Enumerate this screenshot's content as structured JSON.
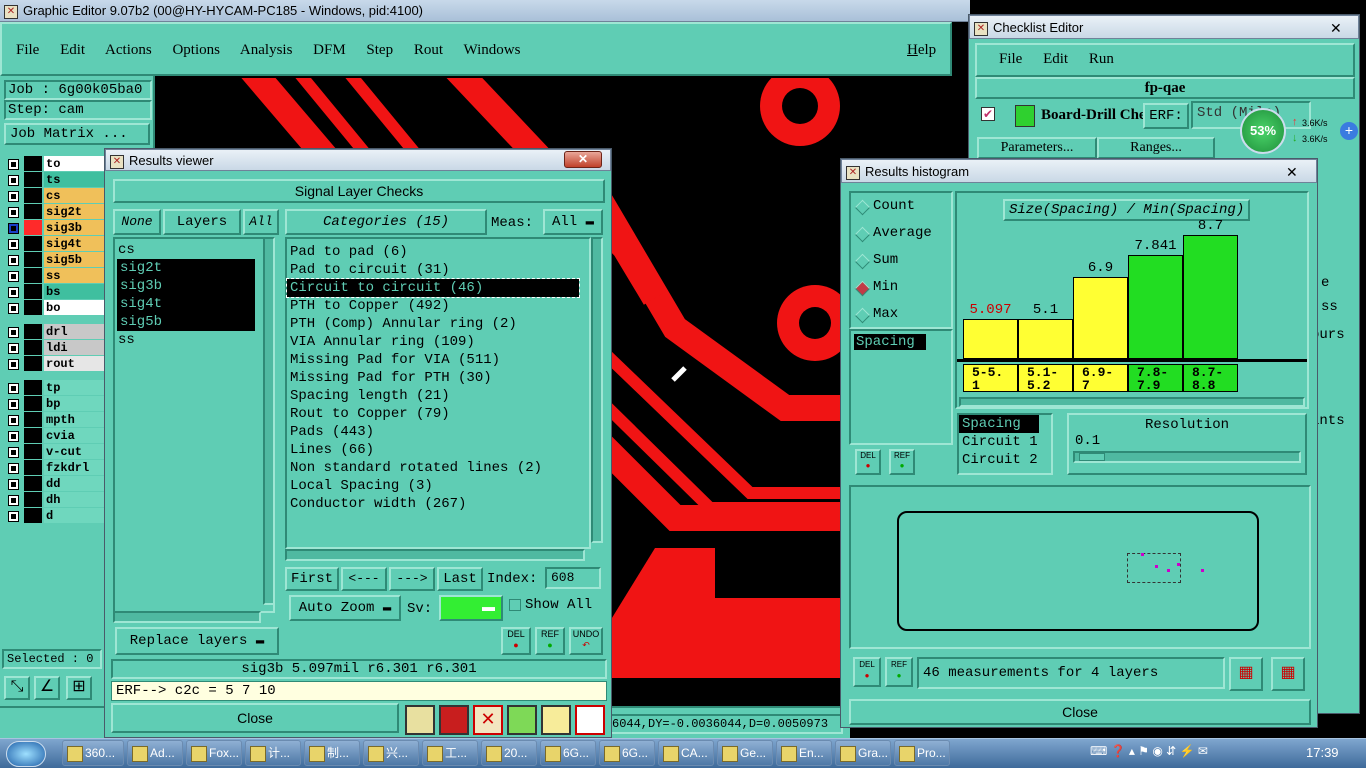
{
  "main_window": {
    "title": "Graphic Editor 9.07b2 (00@HY-HYCAM-PC185 - Windows, pid:4100)",
    "menu": [
      "File",
      "Edit",
      "Actions",
      "Options",
      "Analysis",
      "DFM",
      "Step",
      "Rout",
      "Windows"
    ],
    "help": "Help",
    "job": "Job : 6g00k05ba0",
    "step": "Step: cam",
    "job_matrix": "Job Matrix ...",
    "selected": "Selected : 0",
    "coords": "6044,DY=-0.0036044,D=0.0050973"
  },
  "layers": {
    "board": [
      {
        "name": "to",
        "color": "#ffffff"
      },
      {
        "name": "ts",
        "color": "#3fbf9f"
      },
      {
        "name": "cs",
        "color": "#f0c05a"
      },
      {
        "name": "sig2t",
        "color": "#f0c05a"
      },
      {
        "name": "sig3b",
        "color": "#f0c05a"
      },
      {
        "name": "sig4t",
        "color": "#f0c05a"
      },
      {
        "name": "sig5b",
        "color": "#f0c05a"
      },
      {
        "name": "ss",
        "color": "#f0c05a"
      },
      {
        "name": "bs",
        "color": "#3fbf9f"
      },
      {
        "name": "bo",
        "color": "#ffffff"
      }
    ],
    "drill": [
      {
        "name": "drl",
        "color": "#c8c8c8"
      },
      {
        "name": "ldi",
        "color": "#c8c8c8"
      },
      {
        "name": "rout",
        "color": "#e6e6e6"
      }
    ],
    "misc": [
      {
        "name": "tp",
        "color": "#6fd7be"
      },
      {
        "name": "bp",
        "color": "#6fd7be"
      },
      {
        "name": "mpth",
        "color": "#6fd7be"
      },
      {
        "name": "cvia",
        "color": "#6fd7be"
      },
      {
        "name": "v-cut",
        "color": "#6fd7be"
      },
      {
        "name": "fzkdrl",
        "color": "#6fd7be"
      },
      {
        "name": "dd",
        "color": "#6fd7be"
      },
      {
        "name": "dh",
        "color": "#6fd7be"
      },
      {
        "name": "d",
        "color": "#6fd7be"
      }
    ]
  },
  "results_viewer": {
    "title": "Results viewer",
    "header": "Signal Layer Checks",
    "none_btn": "None",
    "layers_btn": "Layers",
    "all_btn": "All",
    "categories_btn": "Categories (15)",
    "meas_label": "Meas:",
    "meas_value": "All",
    "layers_list": [
      "cs",
      "sig2t",
      "sig3b",
      "sig4t",
      "sig5b",
      "ss"
    ],
    "categories": [
      "Pad to pad (6)",
      "Pad to circuit (31)",
      "Circuit to circuit (46)",
      "PTH to Copper (492)",
      "PTH (Comp) Annular ring (2)",
      "VIA Annular ring (109)",
      "Missing Pad for VIA (511)",
      "Missing Pad for PTH (30)",
      "Spacing length (21)",
      "Rout to Copper (79)",
      "Pads (443)",
      "Lines (66)",
      "Non standard rotated lines (2)",
      "Local Spacing (3)",
      "Conductor width (267)"
    ],
    "first_btn": "First",
    "prev_btn": "<---",
    "next_btn": "--->",
    "last_btn": "Last",
    "index_label": "Index:",
    "index_value": "608",
    "auto_zoom": "Auto Zoom",
    "sv_label": "Sv:",
    "show_all": "Show All",
    "replace_layers": "Replace layers",
    "del_btn": "DEL",
    "ref_btn": "REF",
    "undo_btn": "UNDO",
    "status": "sig3b 5.097mil  r6.301  r6.301",
    "erf": "ERF--> c2c = 5 7 10",
    "close": "Close"
  },
  "histogram": {
    "title": "Results histogram",
    "modes": [
      "Count",
      "Average",
      "Sum",
      "Min",
      "Max"
    ],
    "selected_mode": "Min",
    "spacing_item": "Spacing",
    "chart_title": "Size(Spacing) / Min(Spacing)",
    "resolution_label": "Resolution",
    "resolution_value": "0.1",
    "list": [
      "Spacing",
      "Circuit 1",
      "Circuit 2"
    ],
    "summary": "46 measurements for 4 layers",
    "del_btn": "DEL",
    "ref_btn": "REF",
    "close": "Close",
    "chart_data": {
      "type": "bar",
      "title": "Size(Spacing) / Min(Spacing)",
      "categories": [
        "5-5.1",
        "5.1-5.2",
        "6.9-7",
        "7.8-7.9",
        "8.7-8.8"
      ],
      "values": [
        5.097,
        5.1,
        6.9,
        7.841,
        8.7
      ],
      "value_labels": [
        "5.097",
        "5.1",
        "6.9",
        "7.841",
        "8.7"
      ],
      "bar_colors": [
        "#ffff33",
        "#ffff33",
        "#ffff33",
        "#22dd22",
        "#22dd22"
      ],
      "highlight_first_label_color": "#cc0000"
    }
  },
  "checklist": {
    "title": "Checklist Editor",
    "menu": [
      "File",
      "Edit",
      "Run"
    ],
    "name": "fp-qae",
    "row_label": "Board-Drill Che",
    "erf": "ERF:",
    "erf_value": "Std (Mils)",
    "parameters": "Parameters...",
    "ranges": "Ranges...",
    "side_texts": [
      "e",
      "ss",
      "ours",
      "ints"
    ]
  },
  "net_widget": {
    "percent": "53%",
    "up": "3.6K/s",
    "down": "3.6K/s"
  },
  "taskbar": {
    "items": [
      "360...",
      "Ad...",
      "Fox...",
      "计...",
      "制...",
      "兴...",
      "工...",
      "20...",
      "6G...",
      "6G...",
      "CA...",
      "Ge...",
      "En...",
      "Gra...",
      "Pro..."
    ],
    "time": "17:39"
  }
}
